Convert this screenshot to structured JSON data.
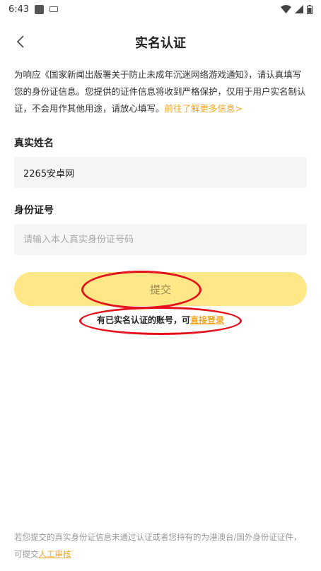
{
  "status_bar": {
    "time": "6:43"
  },
  "header": {
    "title": "实名认证"
  },
  "notice": {
    "text": "为响应《国家新闻出版署关于防止未成年沉迷网络游戏通知》，请认真填写您的身份证信息。您提供的证件信息将收到严格保护，仅用于用户实名制认证，不会用作其他用途，请放心填写。",
    "link": "前往了解更多信息>"
  },
  "form": {
    "name_label": "真实姓名",
    "name_value": "2265安卓网",
    "id_label": "身份证号",
    "id_placeholder": "请输入本人真实身份证号码",
    "submit_label": "提交"
  },
  "login": {
    "prefix": "有已实名认证的账号，可",
    "link": "直接登录"
  },
  "footer": {
    "text": "若您提交的真实身份证信息未通过认证或者您持有的为港澳台/国外身份证证件，可提交",
    "link": "人工审核"
  },
  "colors": {
    "accent": "#f5a623",
    "button_bg": "#fde786",
    "annotation": "#e3121c"
  }
}
